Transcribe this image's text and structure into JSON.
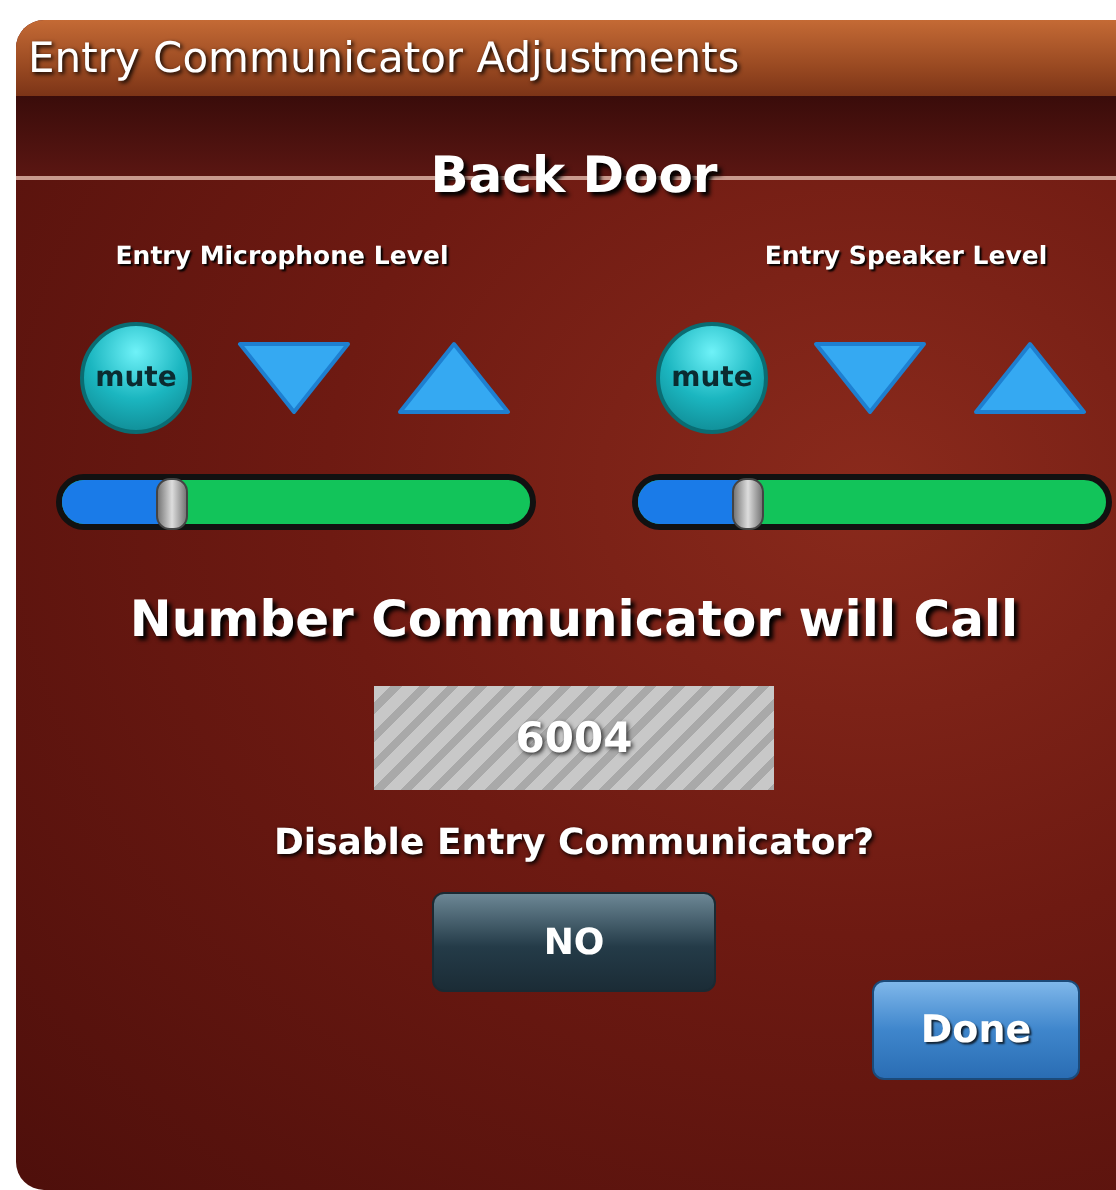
{
  "window": {
    "title": "Entry Communicator Adjustments"
  },
  "location": "Back Door",
  "channels": [
    {
      "label": "Entry Microphone Level",
      "mute_label": "mute",
      "muted": false,
      "level": 0.23
    },
    {
      "label": "Entry Speaker Level",
      "mute_label": "mute",
      "muted": false,
      "level": 0.23
    }
  ],
  "call_number": {
    "label": "Number Communicator will Call",
    "value": "6004"
  },
  "disable": {
    "question": "Disable Entry Communicator?",
    "button": "NO",
    "on": false
  },
  "done_button": "Done"
}
